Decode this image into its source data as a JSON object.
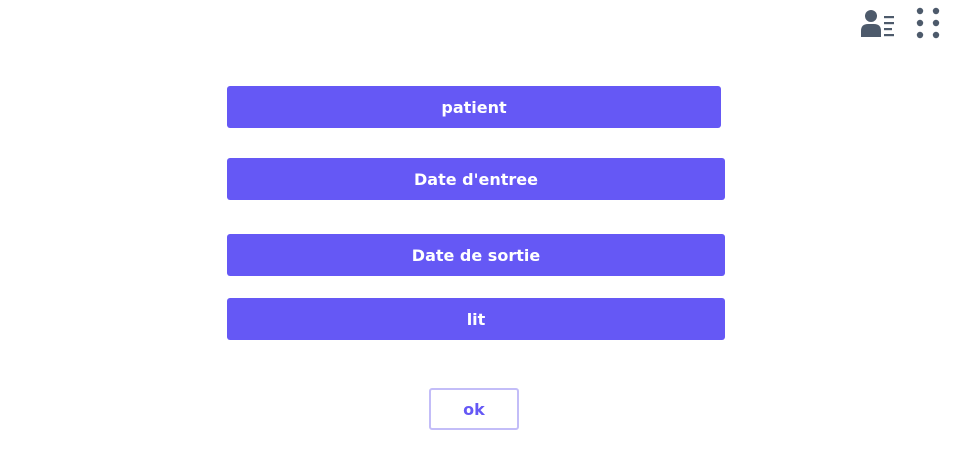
{
  "header": {
    "icons": [
      {
        "name": "contact-list-icon",
        "color": "#4d5a6b"
      },
      {
        "name": "more-dots-icon",
        "color": "#4d5a6b"
      }
    ]
  },
  "fields": {
    "patient_label": "patient",
    "entry_date_label": "Date d'entree",
    "exit_date_label": "Date de sortie",
    "bed_label": "lit"
  },
  "actions": {
    "ok_label": "ok"
  },
  "colors": {
    "accent": "#6558f5",
    "ok_border": "#c3bdf8",
    "icon": "#4d5a6b"
  }
}
